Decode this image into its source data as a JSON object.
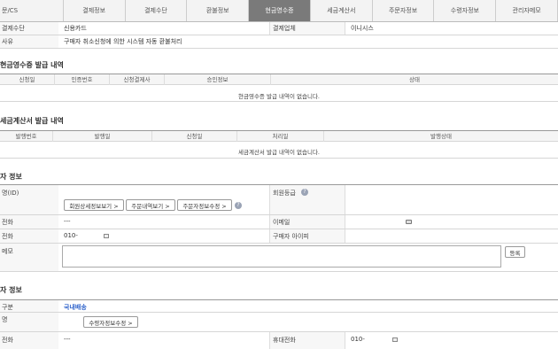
{
  "tabs": [
    "문/CS",
    "결제정보",
    "결제수단",
    "환불정보",
    "현금영수증",
    "세금계산서",
    "주문자정보",
    "수령자정보",
    "관리자메모"
  ],
  "payment": {
    "method_label": "결제수단",
    "method_value": "신용카드",
    "company_label": "결제업체",
    "company_value": "이니시스",
    "reason_label": "사유",
    "reason_value": "구매자 취소신청에 의한 시스템 자동 환불처리"
  },
  "cash_receipt": {
    "title": "현금영수증 발급 내역",
    "columns": [
      "신청일",
      "인증번호",
      "신청결제사",
      "승인정보",
      "상태"
    ],
    "empty": "현금영수증 발급 내역이 없습니다."
  },
  "tax_invoice": {
    "title": "세금계산서 발급 내역",
    "columns": [
      "발행번호",
      "발행일",
      "신청일",
      "처리일",
      "발행상태"
    ],
    "empty": "세금계산서 발급 내역이 없습니다."
  },
  "orderer": {
    "title": "자 정보",
    "name_label": "명(ID)",
    "btn_member": "회원상세정보보기 >",
    "btn_orders": "주문내역보기 >",
    "btn_edit": "주문자정보수정 >",
    "grade_label": "회원등급",
    "phone_label": "전화",
    "phone_value": "---",
    "email_label": "이메일",
    "mobile_label": "전화",
    "mobile_value": "010-",
    "buyer_ip_label": "구매자 아이피",
    "memo_label": "메모",
    "register_btn": "등록"
  },
  "receiver": {
    "title": "자 정보",
    "type_label": "구분",
    "type_value": "국내배송",
    "name_label": "명",
    "btn_edit": "수령자정보수정 >",
    "phone_label": "전화",
    "phone_value": "---",
    "mobile_label": "휴대전화",
    "mobile_value": "010-"
  },
  "colors": {
    "accent": "#3366cc",
    "tab_active": "#7a7a7a"
  }
}
